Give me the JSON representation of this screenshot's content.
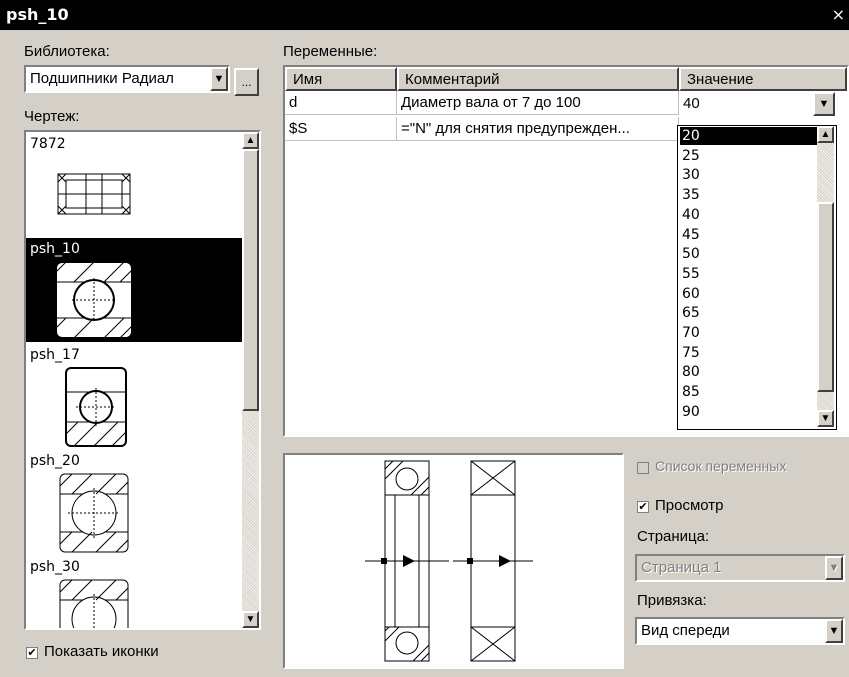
{
  "window": {
    "title": "psh_10",
    "close": "×"
  },
  "library": {
    "label": "Библиотека:",
    "value": "Подшипники Радиал",
    "browse": "..."
  },
  "drawing": {
    "label": "Чертеж:",
    "items": [
      {
        "name": "7872",
        "selected": false
      },
      {
        "name": "psh_10",
        "selected": true
      },
      {
        "name": "psh_17",
        "selected": false
      },
      {
        "name": "psh_20",
        "selected": false
      },
      {
        "name": "psh_30",
        "selected": false
      }
    ]
  },
  "show_icons": {
    "label": "Показать иконки",
    "checked": true
  },
  "variables": {
    "label": "Переменные:",
    "columns": [
      "Имя",
      "Комментарий",
      "Значение"
    ],
    "rows": [
      {
        "name": "d",
        "comment": "Диаметр вала от 7 до 100",
        "value": "40"
      },
      {
        "name": "$S",
        "comment": "=\"N\" для снятия предупрежден...",
        "value": ""
      }
    ],
    "dropdown_options": [
      "20",
      "25",
      "30",
      "35",
      "40",
      "45",
      "50",
      "55",
      "60",
      "65",
      "70",
      "75",
      "80",
      "85",
      "90"
    ],
    "dropdown_selected": "20"
  },
  "var_list": {
    "label": "Список переменных",
    "checked": false,
    "enabled": false
  },
  "preview": {
    "label": "Просмотр",
    "checked": true
  },
  "page": {
    "label": "Страница:",
    "value": "Страница 1",
    "enabled": false
  },
  "binding": {
    "label": "Привязка:",
    "value": "Вид спереди"
  },
  "icons": {
    "dropdown": "chevron-down-icon",
    "up": "arrow-up-icon",
    "down": "arrow-down-icon",
    "check": "checkmark-icon"
  }
}
